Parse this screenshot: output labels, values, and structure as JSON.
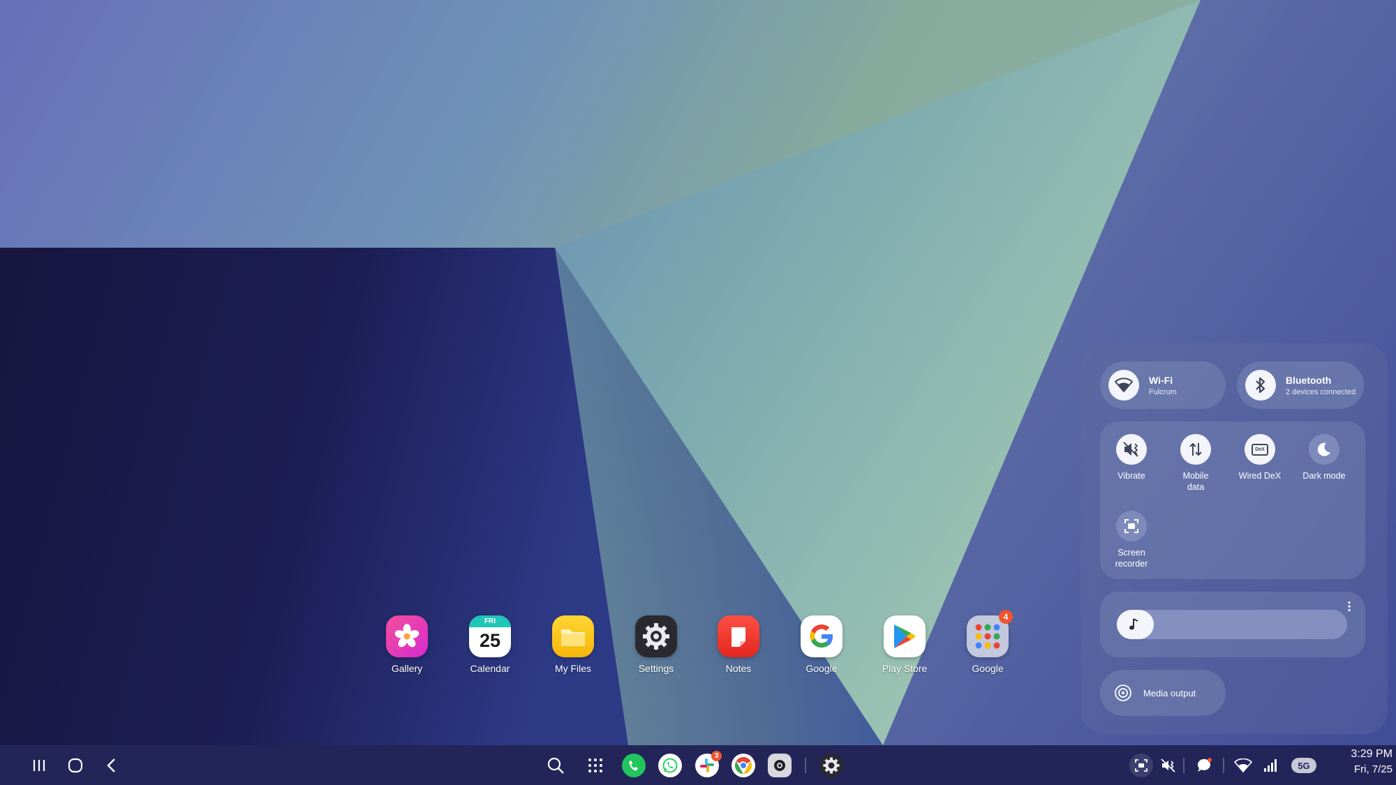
{
  "desktop": {
    "apps": [
      {
        "label": "Gallery",
        "icon": "gallery-icon"
      },
      {
        "label": "Calendar",
        "icon": "calendar-icon",
        "day": "FRI",
        "date": "25"
      },
      {
        "label": "My Files",
        "icon": "folder-icon"
      },
      {
        "label": "Settings",
        "icon": "gear-icon"
      },
      {
        "label": "Notes",
        "icon": "notes-icon"
      },
      {
        "label": "Google",
        "icon": "google-icon"
      },
      {
        "label": "Play Store",
        "icon": "play-store-icon"
      },
      {
        "label": "Google",
        "icon": "folder-grid-icon",
        "badge": "4"
      }
    ]
  },
  "quick_panel": {
    "wifi": {
      "title": "Wi-Fi",
      "subtitle": "Fulcrum",
      "state": "on"
    },
    "bluetooth": {
      "title": "Bluetooth",
      "subtitle": "2 devices connected",
      "state": "on"
    },
    "tiles": [
      {
        "label": "Vibrate",
        "icon": "vibrate-icon",
        "state": "on"
      },
      {
        "label": "Mobile data",
        "icon": "mobile-data-icon",
        "state": "on"
      },
      {
        "label": "Wired DeX",
        "icon": "dex-icon",
        "state": "on",
        "glyph": "DeX"
      },
      {
        "label": "Dark mode",
        "icon": "moon-icon",
        "state": "off"
      },
      {
        "label": "Screen recorder",
        "icon": "screen-recorder-icon",
        "state": "off"
      }
    ],
    "volume": {
      "icon": "music-note-icon",
      "level": 0.16
    },
    "media_output": {
      "label": "Media output"
    }
  },
  "taskbar": {
    "left": [
      "recents-icon",
      "home-icon",
      "back-icon"
    ],
    "center": [
      {
        "icon": "search-icon"
      },
      {
        "icon": "apps-grid-icon"
      },
      {
        "icon": "phone-icon"
      },
      {
        "icon": "whatsapp-icon"
      },
      {
        "icon": "slack-icon",
        "badge": "3"
      },
      {
        "icon": "chrome-icon"
      },
      {
        "icon": "camera-icon"
      },
      {
        "icon": "settings-icon"
      }
    ],
    "status": {
      "network_type": "5G",
      "time": "3:29 PM",
      "date": "Fri, 7/25"
    }
  },
  "colors": {
    "taskbar": "#232559",
    "badge": "#f0552d",
    "panel_tile": "#7886b4"
  }
}
